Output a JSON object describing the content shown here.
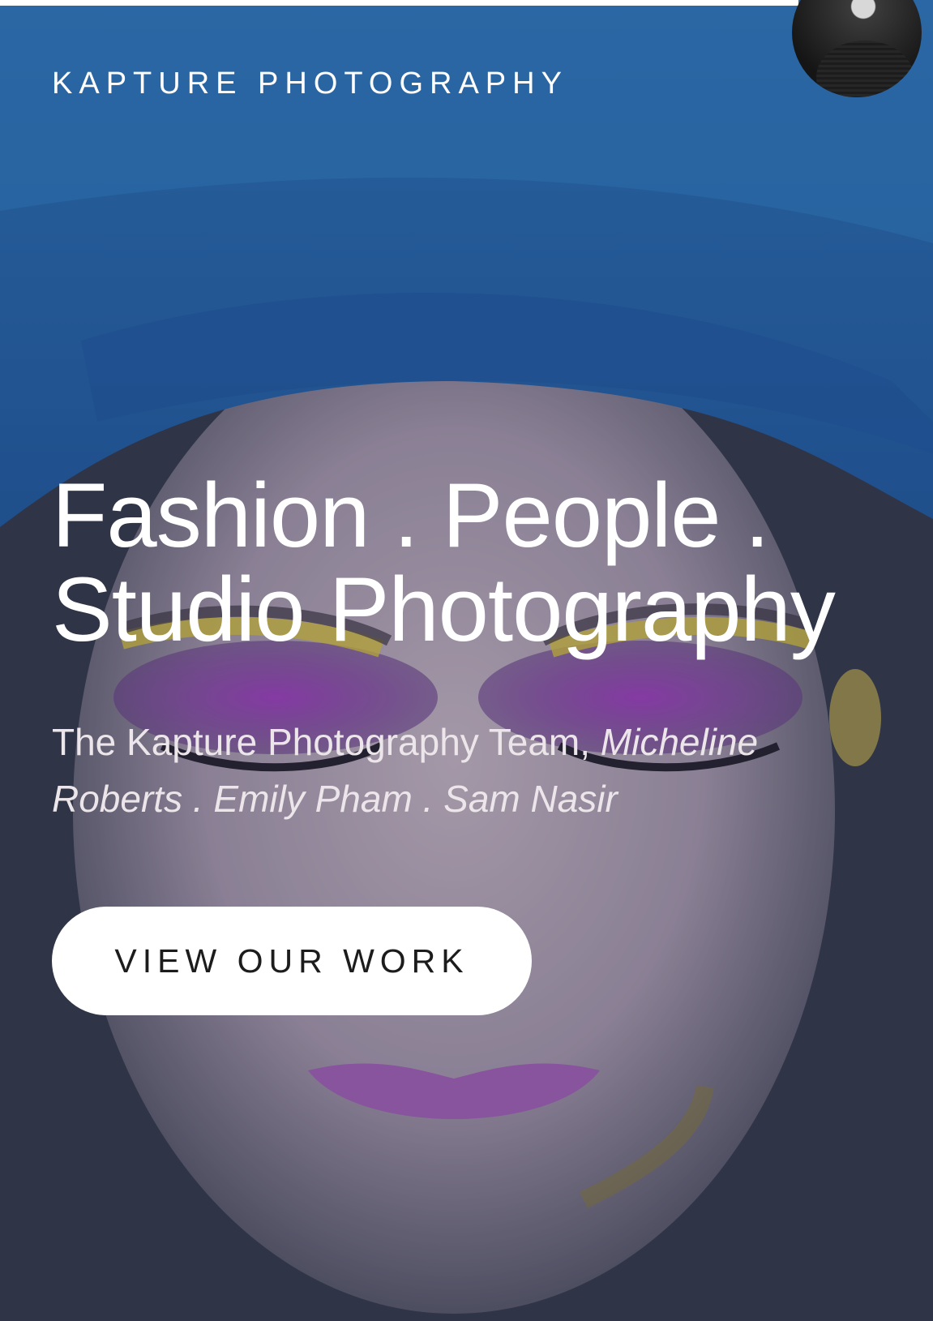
{
  "header": {
    "brand": "KAPTURE PHOTOGRAPHY"
  },
  "hero": {
    "headline_line1": "Fashion . People .",
    "headline_line2": "Studio Photography",
    "tagline_prefix": "The Kapture Photography Team,",
    "tagline_names": "Micheline Roberts . Emily Pham . Sam Nasir",
    "cta_label": "VIEW OUR WORK"
  },
  "colors": {
    "text": "#ffffff",
    "cta_background": "#ffffff",
    "cta_text": "#1c1c1c",
    "hero_blue": "#2a68aa"
  }
}
